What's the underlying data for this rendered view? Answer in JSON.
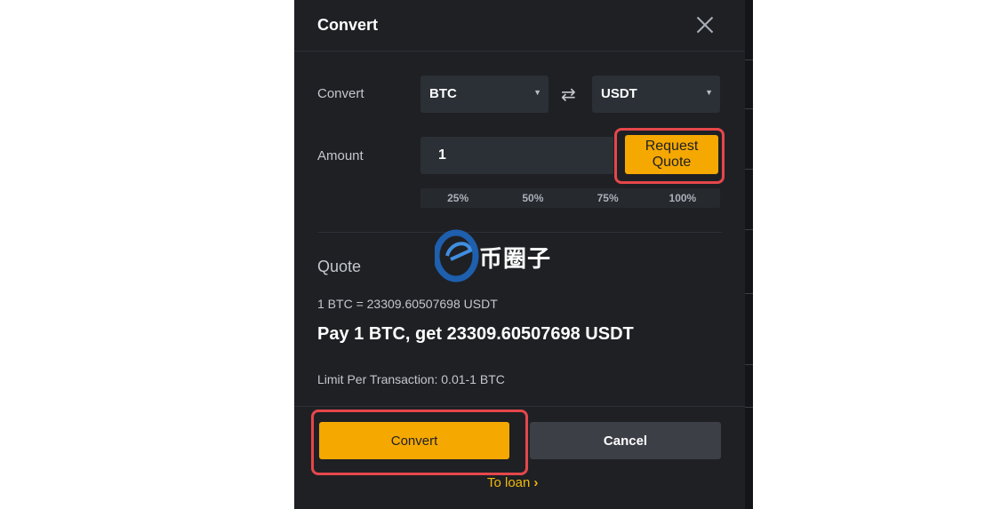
{
  "dialog": {
    "title": "Convert",
    "close_icon": "close-icon"
  },
  "convert_row": {
    "label": "Convert",
    "from": "BTC",
    "to": "USDT",
    "swap_icon": "swap-arrows-icon"
  },
  "amount_row": {
    "label": "Amount",
    "value": "1",
    "request_quote_label": "Request Quote",
    "percentages": [
      "25%",
      "50%",
      "75%",
      "100%"
    ]
  },
  "quote": {
    "heading": "Quote",
    "rate": "1 BTC = 23309.60507698 USDT",
    "pay_text": "Pay 1 BTC, get 23309.60507698 USDT",
    "limit": "Limit Per Transaction: 0.01-1 BTC"
  },
  "footer": {
    "convert_label": "Convert",
    "cancel_label": "Cancel",
    "loan_label": "To loan",
    "loan_icon": "chevron-right-icon"
  },
  "watermark": {
    "text": "币圈子"
  },
  "colors": {
    "modal_bg": "#1f2024",
    "accent": "#f5a800",
    "highlight": "#e5474b",
    "link": "#f0b90b"
  }
}
